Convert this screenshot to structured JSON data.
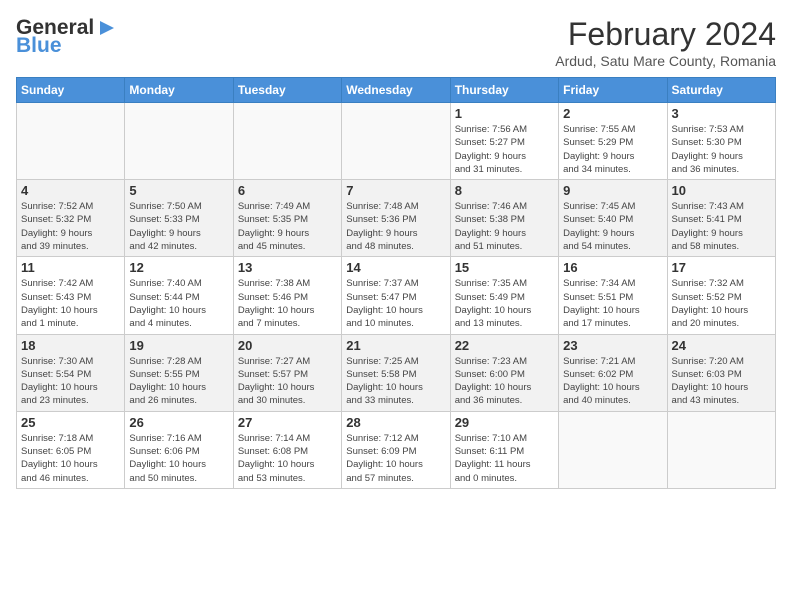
{
  "header": {
    "logo_line1": "General",
    "logo_line2": "Blue",
    "title": "February 2024",
    "subtitle": "Ardud, Satu Mare County, Romania"
  },
  "days_of_week": [
    "Sunday",
    "Monday",
    "Tuesday",
    "Wednesday",
    "Thursday",
    "Friday",
    "Saturday"
  ],
  "weeks": [
    [
      {
        "day": "",
        "info": ""
      },
      {
        "day": "",
        "info": ""
      },
      {
        "day": "",
        "info": ""
      },
      {
        "day": "",
        "info": ""
      },
      {
        "day": "1",
        "info": "Sunrise: 7:56 AM\nSunset: 5:27 PM\nDaylight: 9 hours\nand 31 minutes."
      },
      {
        "day": "2",
        "info": "Sunrise: 7:55 AM\nSunset: 5:29 PM\nDaylight: 9 hours\nand 34 minutes."
      },
      {
        "day": "3",
        "info": "Sunrise: 7:53 AM\nSunset: 5:30 PM\nDaylight: 9 hours\nand 36 minutes."
      }
    ],
    [
      {
        "day": "4",
        "info": "Sunrise: 7:52 AM\nSunset: 5:32 PM\nDaylight: 9 hours\nand 39 minutes."
      },
      {
        "day": "5",
        "info": "Sunrise: 7:50 AM\nSunset: 5:33 PM\nDaylight: 9 hours\nand 42 minutes."
      },
      {
        "day": "6",
        "info": "Sunrise: 7:49 AM\nSunset: 5:35 PM\nDaylight: 9 hours\nand 45 minutes."
      },
      {
        "day": "7",
        "info": "Sunrise: 7:48 AM\nSunset: 5:36 PM\nDaylight: 9 hours\nand 48 minutes."
      },
      {
        "day": "8",
        "info": "Sunrise: 7:46 AM\nSunset: 5:38 PM\nDaylight: 9 hours\nand 51 minutes."
      },
      {
        "day": "9",
        "info": "Sunrise: 7:45 AM\nSunset: 5:40 PM\nDaylight: 9 hours\nand 54 minutes."
      },
      {
        "day": "10",
        "info": "Sunrise: 7:43 AM\nSunset: 5:41 PM\nDaylight: 9 hours\nand 58 minutes."
      }
    ],
    [
      {
        "day": "11",
        "info": "Sunrise: 7:42 AM\nSunset: 5:43 PM\nDaylight: 10 hours\nand 1 minute."
      },
      {
        "day": "12",
        "info": "Sunrise: 7:40 AM\nSunset: 5:44 PM\nDaylight: 10 hours\nand 4 minutes."
      },
      {
        "day": "13",
        "info": "Sunrise: 7:38 AM\nSunset: 5:46 PM\nDaylight: 10 hours\nand 7 minutes."
      },
      {
        "day": "14",
        "info": "Sunrise: 7:37 AM\nSunset: 5:47 PM\nDaylight: 10 hours\nand 10 minutes."
      },
      {
        "day": "15",
        "info": "Sunrise: 7:35 AM\nSunset: 5:49 PM\nDaylight: 10 hours\nand 13 minutes."
      },
      {
        "day": "16",
        "info": "Sunrise: 7:34 AM\nSunset: 5:51 PM\nDaylight: 10 hours\nand 17 minutes."
      },
      {
        "day": "17",
        "info": "Sunrise: 7:32 AM\nSunset: 5:52 PM\nDaylight: 10 hours\nand 20 minutes."
      }
    ],
    [
      {
        "day": "18",
        "info": "Sunrise: 7:30 AM\nSunset: 5:54 PM\nDaylight: 10 hours\nand 23 minutes."
      },
      {
        "day": "19",
        "info": "Sunrise: 7:28 AM\nSunset: 5:55 PM\nDaylight: 10 hours\nand 26 minutes."
      },
      {
        "day": "20",
        "info": "Sunrise: 7:27 AM\nSunset: 5:57 PM\nDaylight: 10 hours\nand 30 minutes."
      },
      {
        "day": "21",
        "info": "Sunrise: 7:25 AM\nSunset: 5:58 PM\nDaylight: 10 hours\nand 33 minutes."
      },
      {
        "day": "22",
        "info": "Sunrise: 7:23 AM\nSunset: 6:00 PM\nDaylight: 10 hours\nand 36 minutes."
      },
      {
        "day": "23",
        "info": "Sunrise: 7:21 AM\nSunset: 6:02 PM\nDaylight: 10 hours\nand 40 minutes."
      },
      {
        "day": "24",
        "info": "Sunrise: 7:20 AM\nSunset: 6:03 PM\nDaylight: 10 hours\nand 43 minutes."
      }
    ],
    [
      {
        "day": "25",
        "info": "Sunrise: 7:18 AM\nSunset: 6:05 PM\nDaylight: 10 hours\nand 46 minutes."
      },
      {
        "day": "26",
        "info": "Sunrise: 7:16 AM\nSunset: 6:06 PM\nDaylight: 10 hours\nand 50 minutes."
      },
      {
        "day": "27",
        "info": "Sunrise: 7:14 AM\nSunset: 6:08 PM\nDaylight: 10 hours\nand 53 minutes."
      },
      {
        "day": "28",
        "info": "Sunrise: 7:12 AM\nSunset: 6:09 PM\nDaylight: 10 hours\nand 57 minutes."
      },
      {
        "day": "29",
        "info": "Sunrise: 7:10 AM\nSunset: 6:11 PM\nDaylight: 11 hours\nand 0 minutes."
      },
      {
        "day": "",
        "info": ""
      },
      {
        "day": "",
        "info": ""
      }
    ]
  ]
}
